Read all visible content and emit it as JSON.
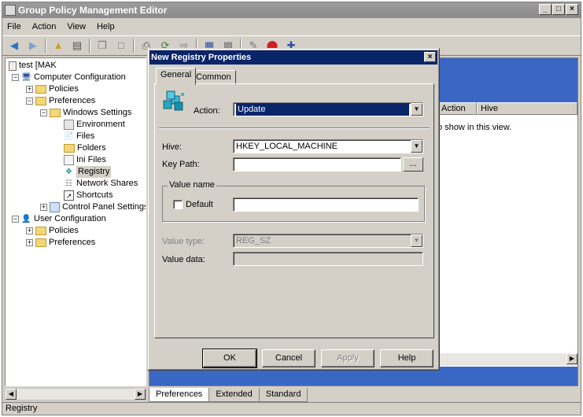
{
  "window": {
    "title": "Group Policy Management Editor",
    "controls": [
      "_",
      "□",
      "×"
    ]
  },
  "menu": [
    "File",
    "Action",
    "View",
    "Help"
  ],
  "tree": {
    "root": "test [MAK",
    "computer_configuration": "Computer Configuration",
    "policies": "Policies",
    "preferences": "Preferences",
    "windows_settings": "Windows Settings",
    "environment": "Environment",
    "files": "Files",
    "folders": "Folders",
    "ini_files": "Ini Files",
    "registry": "Registry",
    "network_shares": "Network Shares",
    "shortcuts": "Shortcuts",
    "control_panel_settings": "Control Panel Settings",
    "user_configuration": "User Configuration",
    "user_policies": "Policies",
    "user_preferences": "Preferences"
  },
  "list": {
    "columns": [
      "Action",
      "Hive"
    ],
    "empty_message": "o show in this view."
  },
  "bottom_tabs": [
    "Preferences",
    "Extended",
    "Standard"
  ],
  "status": "Registry",
  "dialog": {
    "title": "New Registry Properties",
    "tabs": [
      "General",
      "Common"
    ],
    "action_label": "Action:",
    "action_value": "Update",
    "hive_label": "Hive:",
    "hive_value": "HKEY_LOCAL_MACHINE",
    "key_path_label": "Key Path:",
    "key_path_value": "",
    "browse_label": "...",
    "value_name_group": "Value name",
    "default_label": "Default",
    "value_name_value": "",
    "value_type_label": "Value type:",
    "value_type_value": "REG_SZ",
    "value_data_label": "Value data:",
    "value_data_value": "",
    "buttons": {
      "ok": "OK",
      "cancel": "Cancel",
      "apply": "Apply",
      "help": "Help"
    }
  }
}
